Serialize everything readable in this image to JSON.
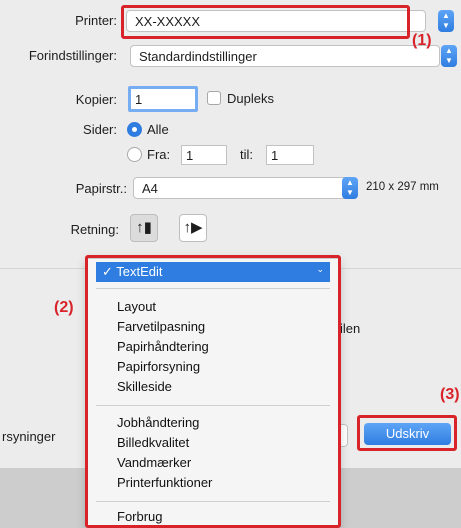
{
  "printer": {
    "label": "Printer:",
    "value": "XX-XXXXX"
  },
  "presets": {
    "label": "Forindstillinger:",
    "value": "Standardindstillinger"
  },
  "copies": {
    "label": "Kopier:",
    "value": "1",
    "duplex_label": "Dupleks"
  },
  "pages": {
    "label": "Sider:",
    "all_label": "Alle",
    "from_label": "Fra:",
    "from_value": "1",
    "to_label": "til:",
    "to_value": "1"
  },
  "paper": {
    "label": "Papirstr.:",
    "value": "A4",
    "dims": "210 x 297 mm"
  },
  "orientation": {
    "label": "Retning:"
  },
  "popup_menu": {
    "selected": "TextEdit",
    "group1": [
      "Layout",
      "Farvetilpasning",
      "Papirhåndtering",
      "Papirforsyning",
      "Skilleside"
    ],
    "group2": [
      "Jobhåndtering",
      "Billedkvalitet",
      "Vandmærker",
      "Printerfunktioner"
    ],
    "group3": [
      "Forbrug"
    ]
  },
  "background_text": {
    "partial_right": "ilen",
    "supplies": "rsyninger",
    "partial_btn": "r"
  },
  "print_button": "Udskriv",
  "callouts": {
    "c1": "(1)",
    "c2": "(2)",
    "c3": "(3)"
  },
  "colors": {
    "accent": "#2f7de1",
    "callout_red": "#d8232a"
  }
}
